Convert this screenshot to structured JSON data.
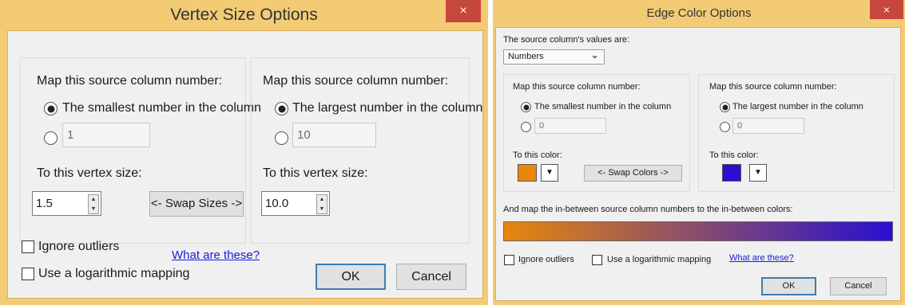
{
  "vertex": {
    "title": "Vertex Size Options",
    "close_glyph": "×",
    "left": {
      "header": "Map this source column number:",
      "option_smallest": "The smallest number in the column",
      "custom_value": "1",
      "to_size_label": "To this vertex size:",
      "size_value": "1.5"
    },
    "right": {
      "header": "Map this source column number:",
      "option_largest": "The largest number in the column",
      "custom_value": "10",
      "to_size_label": "To this vertex size:",
      "size_value": "10.0"
    },
    "swap_label": "<- Swap Sizes ->",
    "ignore_outliers": "Ignore outliers",
    "log_mapping": "Use a logarithmic mapping",
    "what_link": "What are these?",
    "ok": "OK",
    "cancel": "Cancel"
  },
  "edge": {
    "title": "Edge Color Options",
    "close_glyph": "×",
    "values_label": "The source column's values are:",
    "values_selected": "Numbers",
    "left": {
      "header": "Map this source column number:",
      "option_smallest": "The smallest number in the column",
      "custom_value": "0",
      "to_color_label": "To this color:",
      "color": "#e8870c"
    },
    "right": {
      "header": "Map this source column number:",
      "option_largest": "The largest number in the column",
      "custom_value": "0",
      "to_color_label": "To this color:",
      "color": "#2a0fd0"
    },
    "swap_label": "<- Swap Colors ->",
    "between_label": "And map the in-between source column numbers to the in-between colors:",
    "ignore_outliers": "Ignore outliers",
    "log_mapping": "Use a logarithmic mapping",
    "what_link": "What are these?",
    "ok": "OK",
    "cancel": "Cancel"
  },
  "icons": {
    "dropdown": "▼",
    "spin_up": "▲",
    "spin_down": "▼",
    "select_chevron": "⌄"
  },
  "colors": {
    "titlebar": "#f3cb74",
    "close": "#c7473c",
    "link": "#1b1bd6"
  }
}
